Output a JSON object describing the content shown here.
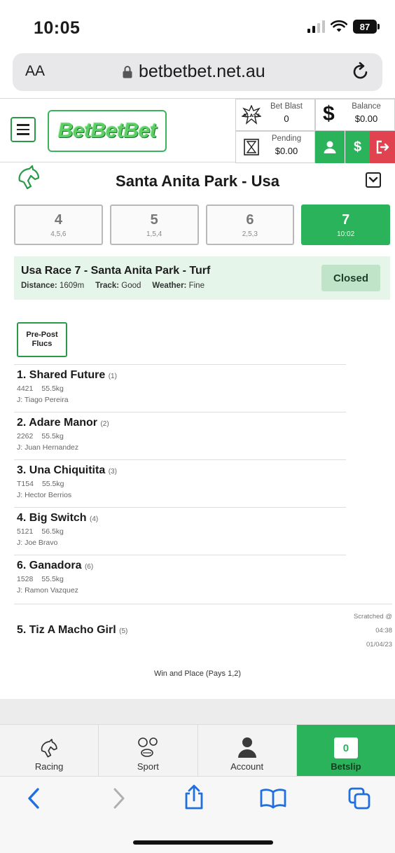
{
  "status": {
    "time": "10:05",
    "battery": "87"
  },
  "browser": {
    "aa": "AA",
    "url": "betbetbet.net.au"
  },
  "header": {
    "logo": "BetBetBet",
    "bet_blast_label": "Bet Blast",
    "bet_blast_value": "0",
    "pending_label": "Pending",
    "pending_value": "$0.00",
    "balance_label": "Balance",
    "balance_value": "$0.00",
    "deposit_symbol": "$"
  },
  "venue": {
    "title": "Santa Anita Park - Usa"
  },
  "race_tabs": [
    {
      "number": "4",
      "sub": "4,5,6"
    },
    {
      "number": "5",
      "sub": "1,5,4"
    },
    {
      "number": "6",
      "sub": "2,5,3"
    },
    {
      "number": "7",
      "sub": "10:02"
    }
  ],
  "race": {
    "name": "Usa Race 7 - Santa Anita Park - Turf",
    "distance_label": "Distance:",
    "distance": "1609m",
    "track_label": "Track:",
    "track": "Good",
    "weather_label": "Weather:",
    "weather": "Fine",
    "status": "Closed"
  },
  "flucs_button": {
    "line1": "Pre-Post",
    "line2": "Flucs"
  },
  "runners": [
    {
      "name": "1. Shared Future",
      "barrier": "(1)",
      "form": "4421",
      "weight": "55.5kg",
      "jockey": "J: Tiago Pereira"
    },
    {
      "name": "2. Adare Manor",
      "barrier": "(2)",
      "form": "2262",
      "weight": "55.5kg",
      "jockey": "J: Juan Hernandez"
    },
    {
      "name": "3. Una Chiquitita",
      "barrier": "(3)",
      "form": "T154",
      "weight": "55.5kg",
      "jockey": "J: Hector Berrios"
    },
    {
      "name": "4. Big Switch",
      "barrier": "(4)",
      "form": "5121",
      "weight": "56.5kg",
      "jockey": "J: Joe Bravo"
    },
    {
      "name": "6. Ganadora",
      "barrier": "(6)",
      "form": "1528",
      "weight": "55.5kg",
      "jockey": "J: Ramon Vazquez"
    }
  ],
  "scratched": {
    "name": "5. Tiz A Macho Girl",
    "barrier": "(5)",
    "label": "Scratched @",
    "time": "04:38",
    "date": "01/04/23"
  },
  "dividend_note": "Win and Place (Pays 1,2)",
  "bottom_nav": {
    "racing": "Racing",
    "sport": "Sport",
    "account": "Account",
    "betslip": "Betslip",
    "betslip_count": "0"
  },
  "colors": {
    "brand_green": "#2ab35a",
    "logout_red": "#e0434f",
    "info_bg": "#e6f5ea"
  }
}
